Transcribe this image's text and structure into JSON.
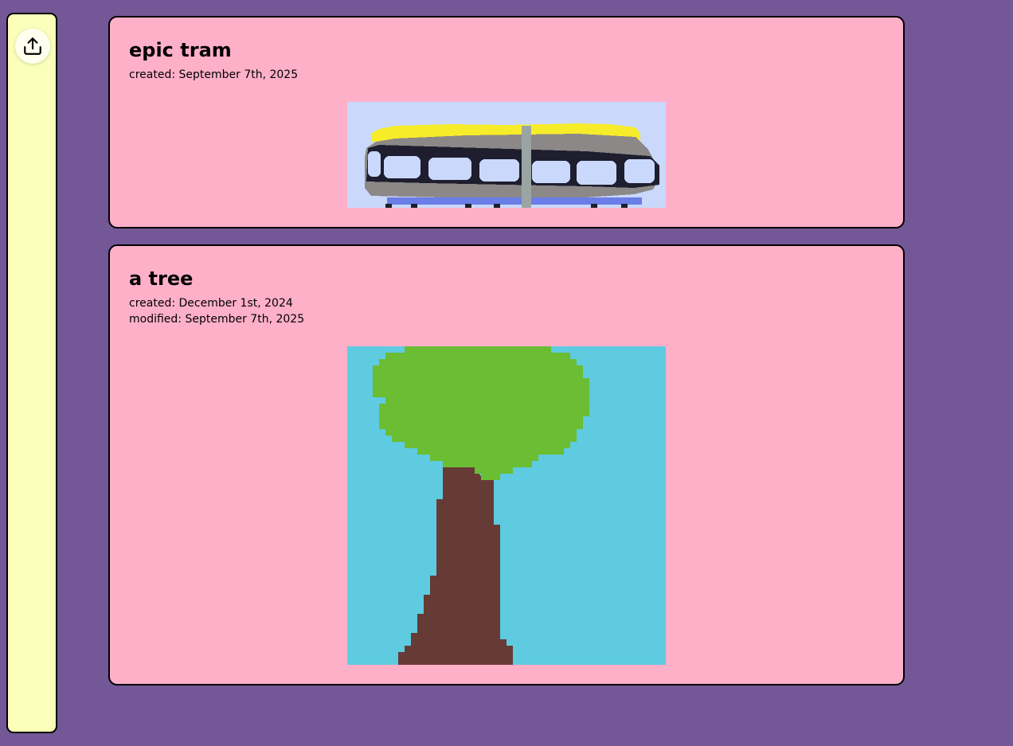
{
  "sidebar": {
    "upload_icon": "upload-icon"
  },
  "drawings": [
    {
      "title": "epic tram",
      "created": "created: September 7th, 2025",
      "thumbnail_icon": "tram-drawing"
    },
    {
      "title": "a tree",
      "created": "created: December 1st, 2024",
      "modified": "modified: September 7th, 2025",
      "thumbnail_icon": "tree-drawing"
    }
  ],
  "colors": {
    "background": "#745796",
    "sidebar": "#fbffb9",
    "card": "#ffb0c9",
    "tram_sky": "#c9d8fb",
    "tree_sky": "#5ecbe1",
    "tree_leaves": "#6bbd33",
    "tree_trunk": "#663b35"
  }
}
